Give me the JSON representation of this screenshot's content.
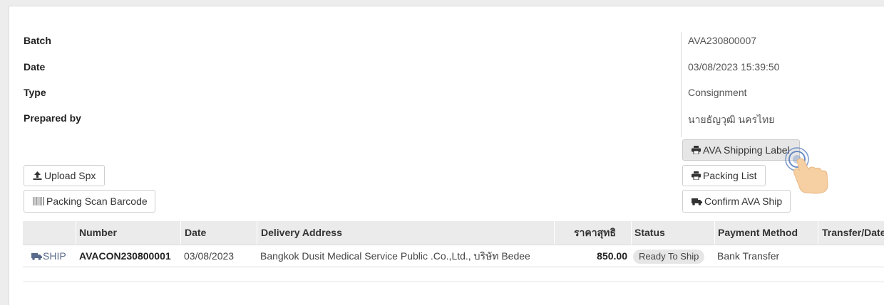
{
  "info": {
    "batch_label": "Batch",
    "batch_value": "AVA230800007",
    "date_label": "Date",
    "date_value": "03/08/2023 15:39:50",
    "type_label": "Type",
    "type_value": "Consignment",
    "prepared_label": "Prepared by",
    "prepared_value": "นายธัญวุฒิ นครไทย"
  },
  "actions": {
    "upload_spx": "Upload Spx",
    "packing_scan_barcode": "Packing Scan Barcode",
    "ava_shipping_label": "AVA Shipping Label",
    "packing_list": "Packing List",
    "confirm_ava_ship": "Confirm AVA Ship"
  },
  "table": {
    "headers": {
      "number": "Number",
      "date": "Date",
      "delivery_address": "Delivery Address",
      "net_price": "ราคาสุทธิ",
      "status": "Status",
      "payment_method": "Payment Method",
      "transfer_date": "Transfer/Date"
    },
    "rows": [
      {
        "ship_label": "SHIP",
        "number": "AVACON230800001",
        "date": "03/08/2023",
        "delivery_address": "Bangkok Dusit Medical Service Public .Co.,Ltd., บริษัท Bedee",
        "net_price": "850.00",
        "status": "Ready To Ship",
        "payment_method": "Bank Transfer",
        "transfer_date": ""
      }
    ]
  },
  "colors": {
    "ship_link": "#5a6b8c",
    "panel_bg": "#ffffff",
    "header_bg": "#ebebeb",
    "badge_bg": "#e6e6e6",
    "hand_cursor": "#f6cfa3",
    "click_ring": "#5b7fbf"
  },
  "icons": {
    "upload": "upload-icon",
    "barcode": "barcode-icon",
    "print": "print-icon",
    "truck": "truck-icon",
    "hand_cursor": "hand-pointer-icon"
  }
}
